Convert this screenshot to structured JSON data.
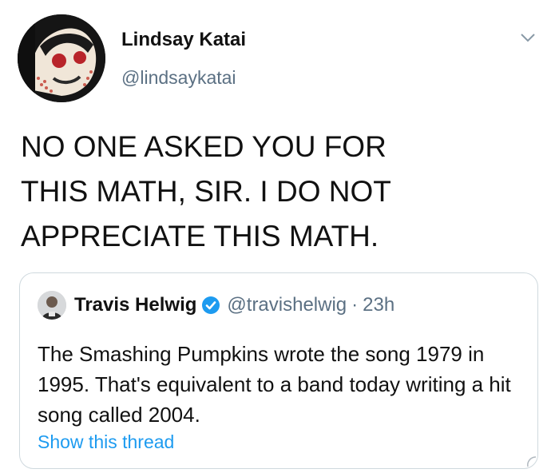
{
  "author": {
    "name": "Lindsay Katai",
    "handle": "@lindsaykatai"
  },
  "tweet": {
    "text": "NO ONE ASKED YOU FOR\nTHIS MATH, SIR. I DO NOT\nAPPRECIATE THIS MATH."
  },
  "quoted": {
    "name": "Travis Helwig",
    "handle": "@travishelwig",
    "separator": "·",
    "time": "23h",
    "text": "The Smashing Pumpkins wrote the song 1979 in 1995. That's equivalent to a band today writing a hit song called 2004.",
    "link": "Show this thread",
    "verified": true
  },
  "colors": {
    "muted": "#5b7083",
    "link": "#1d9bf0",
    "verified_badge": "#1d9bf0",
    "border": "#cfd9de"
  },
  "icons": {
    "menu": "chevron-down-icon",
    "verified": "verified-badge-icon"
  }
}
